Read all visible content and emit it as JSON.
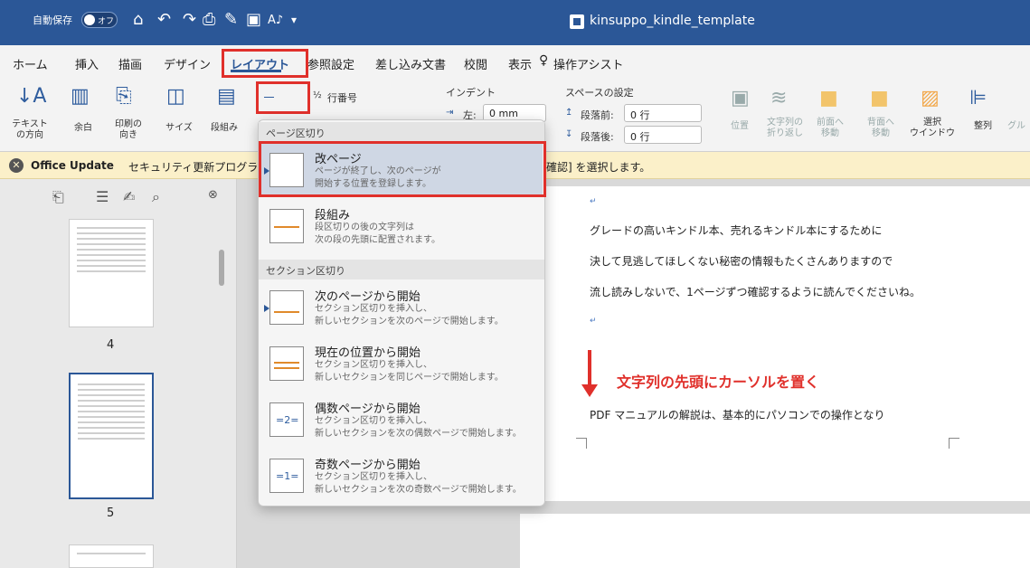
{
  "titlebar": {
    "autosave_label": "自動保存",
    "autosave_state": "オフ",
    "doc_title": "kinsuppo_kindle_template"
  },
  "tabs": [
    "ホーム",
    "挿入",
    "描画",
    "デザイン",
    "レイアウト",
    "参照設定",
    "差し込み文書",
    "校閲",
    "表示",
    "操作アシスト"
  ],
  "ribbon": {
    "text_dir": "テキスト\nの方向",
    "margins": "余白",
    "orientation": "印刷の\n向き",
    "size": "サイズ",
    "columns": "段組み",
    "line_numbers": "行番号",
    "indent_label": "インデント",
    "indent_left": "左:",
    "indent_left_val": "0 mm",
    "spacing_label": "スペースの設定",
    "spacing_before": "段落前:",
    "spacing_before_val": "0 行",
    "spacing_after": "段落後:",
    "spacing_after_val": "0 行",
    "position": "位置",
    "wrap": "文字列の\n折り返し",
    "forward": "前面へ\n移動",
    "backward": "背面へ\n移動",
    "select_pane": "選択\nウインドウ",
    "align": "整列",
    "group": "グル"
  },
  "notice": {
    "title": "Office Update",
    "text": "セキュリティ更新プログラム",
    "text2": "確認] を選択します。"
  },
  "thumbs": {
    "page4": "4",
    "page5": "5"
  },
  "document": {
    "line1": "グレードの高いキンドル本、売れるキンドル本にするために",
    "line2": "決して見逃してほしくない秘密の情報もたくさんありますので",
    "line3": "流し読みしないで、1ページずつ確認するように読んでくださいね。",
    "annotation": "文字列の先頭にカーソルを置く",
    "line4": "PDF マニュアルの解説は、基本的にパソコンでの操作となり"
  },
  "dropdown": {
    "header1": "ページ区切り",
    "item1_title": "改ページ",
    "item1_desc1": "ページが終了し、次のページが",
    "item1_desc2": "開始する位置を登録します。",
    "item2_title": "段組み",
    "item2_desc1": "段区切りの後の文字列は",
    "item2_desc2": "次の段の先頭に配置されます。",
    "header2": "セクション区切り",
    "item3_title": "次のページから開始",
    "item3_desc1": "セクション区切りを挿入し、",
    "item3_desc2": "新しいセクションを次のページで開始します。",
    "item4_title": "現在の位置から開始",
    "item4_desc1": "セクション区切りを挿入し、",
    "item4_desc2": "新しいセクションを同じページで開始します。",
    "item5_title": "偶数ページから開始",
    "item5_desc1": "セクション区切りを挿入し、",
    "item5_desc2": "新しいセクションを次の偶数ページで開始します。",
    "item6_title": "奇数ページから開始",
    "item6_desc1": "セクション区切りを挿入し、",
    "item6_desc2": "新しいセクションを次の奇数ページで開始します。"
  }
}
